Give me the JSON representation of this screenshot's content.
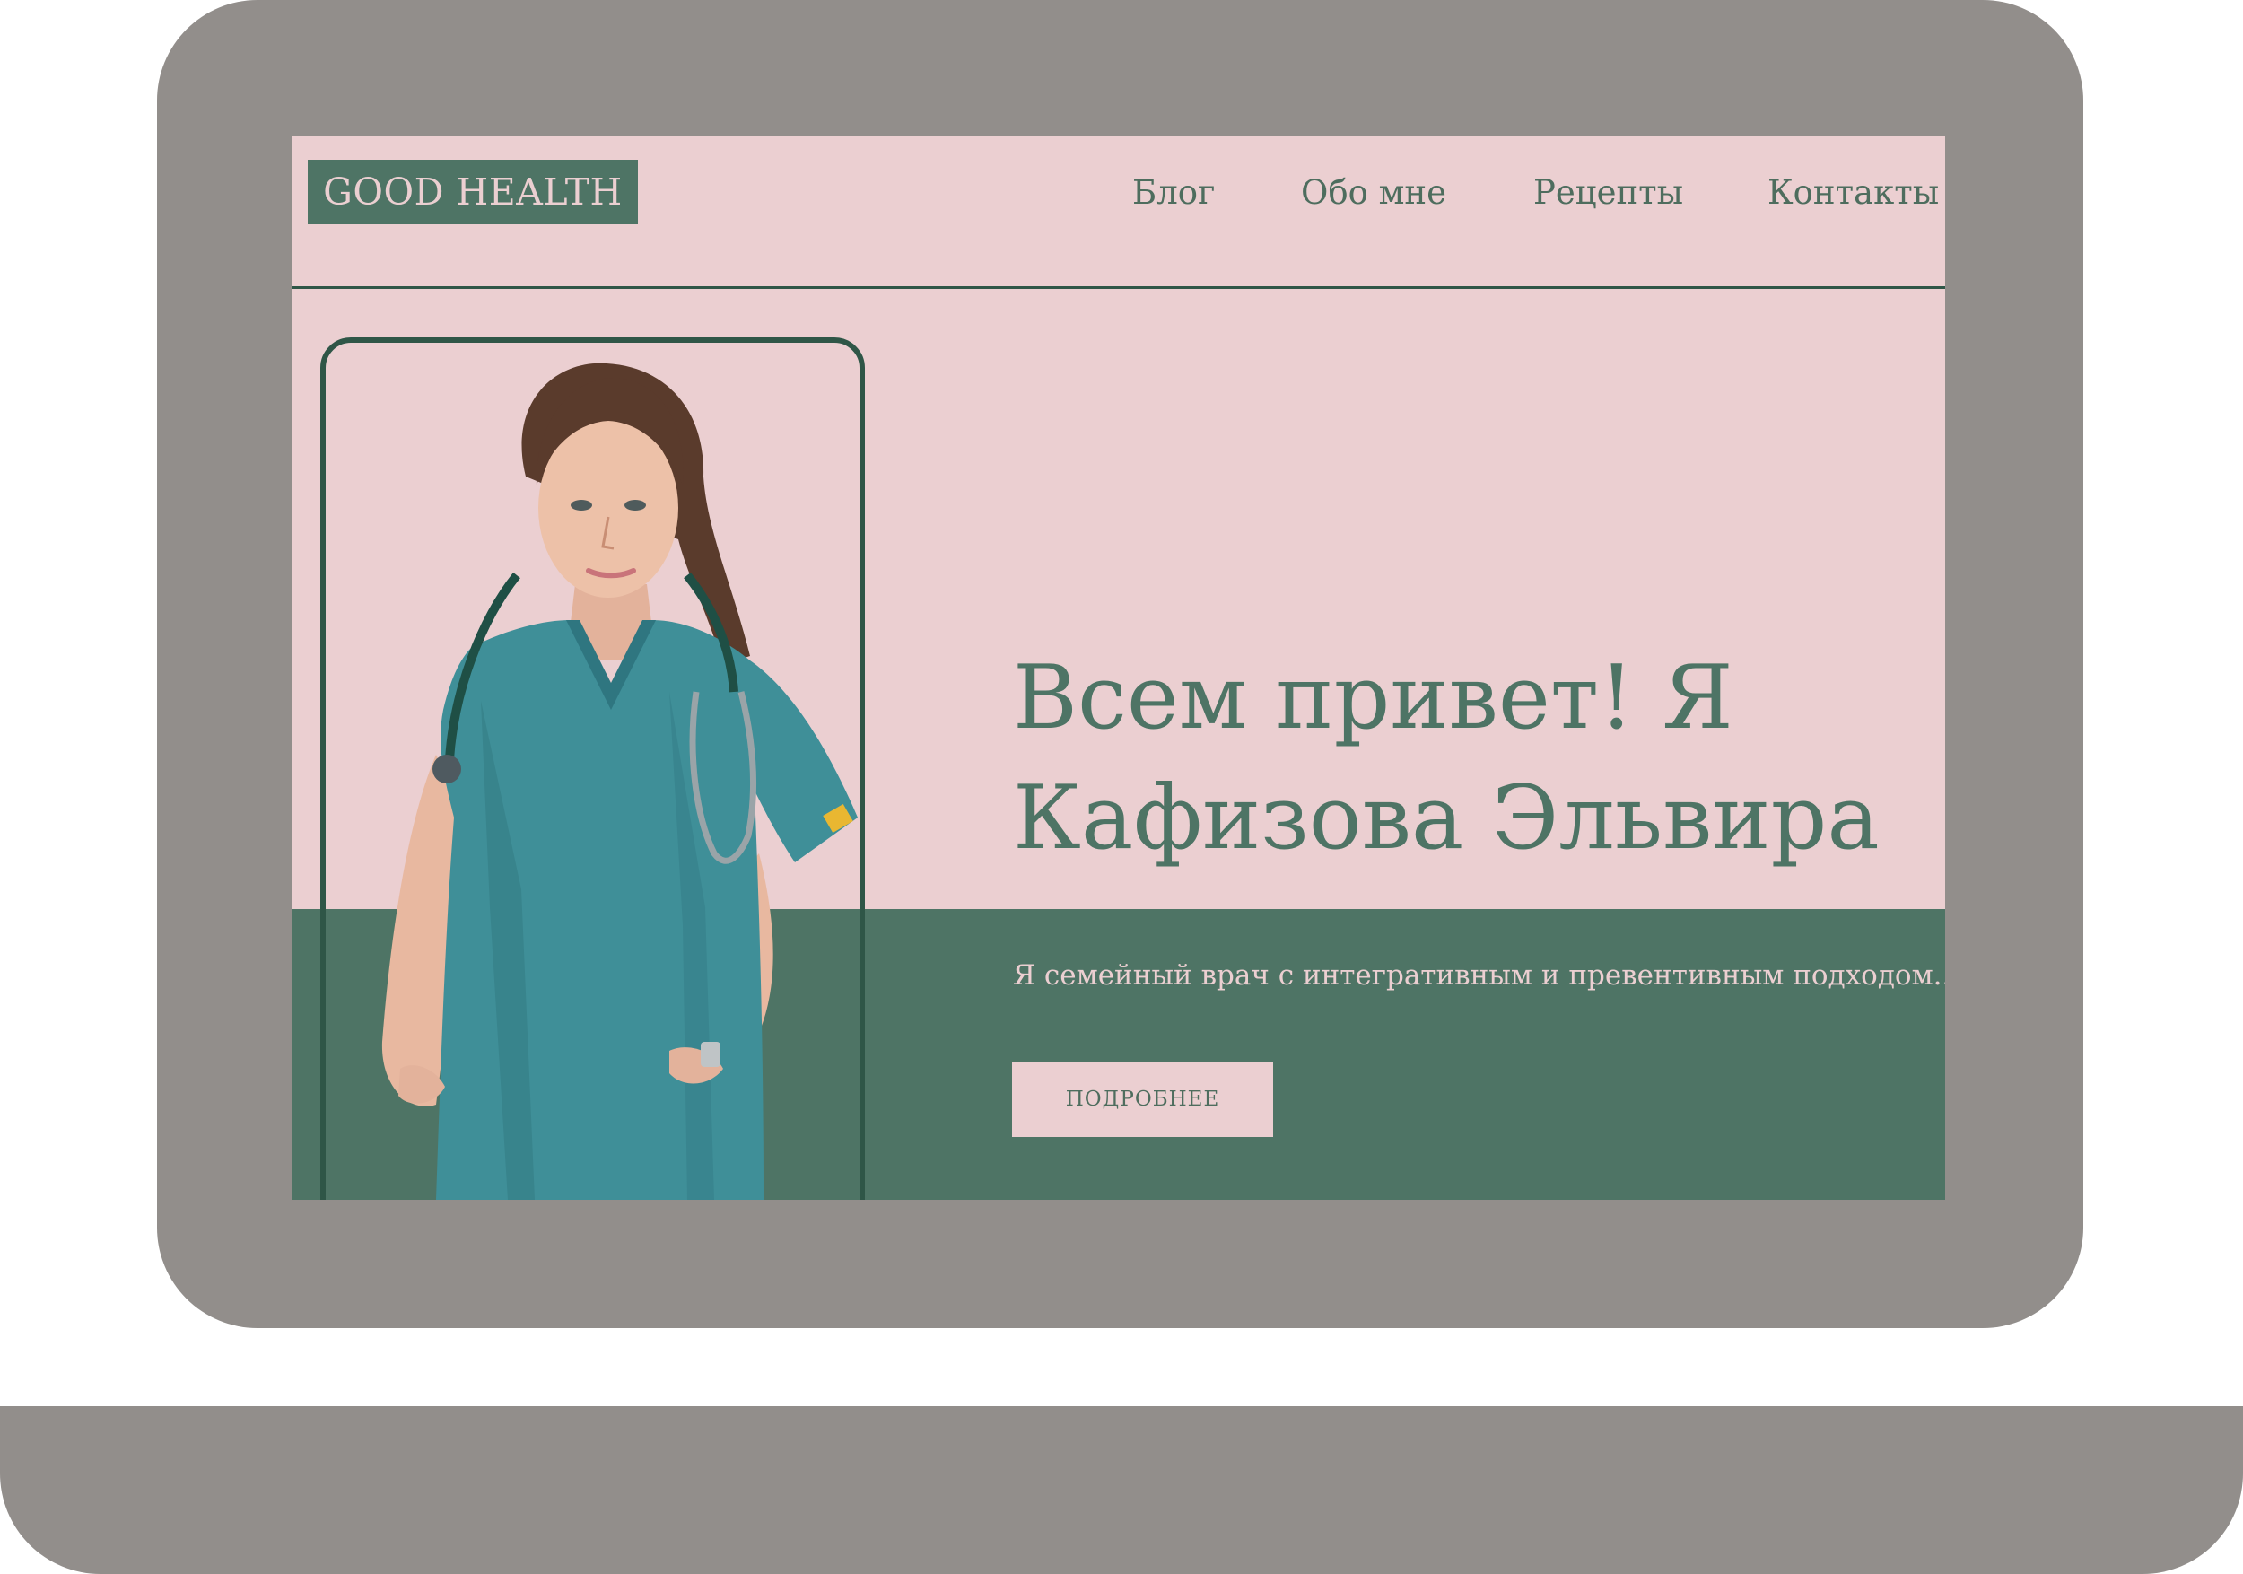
{
  "site": {
    "logo_text": "GOOD HEALTH",
    "nav": [
      {
        "label": "Блог"
      },
      {
        "label": "Обо мне"
      },
      {
        "label": "Рецепты"
      },
      {
        "label": "Контакты"
      }
    ]
  },
  "hero": {
    "headline_line1": "Всем привет! Я",
    "headline_line2": "Кафизова Эльвира",
    "subtitle": "Я семейный врач с интегративным и превентивным подходом...",
    "cta_label": "ПОДРОБНЕЕ",
    "image_subject": "doctor-portrait"
  },
  "colors": {
    "device": "#928e8b",
    "page_background": "#ebcfd1",
    "brand_green": "#4e7465",
    "dark_green": "#2f5647",
    "scrubs_teal": "#3f8f98"
  }
}
